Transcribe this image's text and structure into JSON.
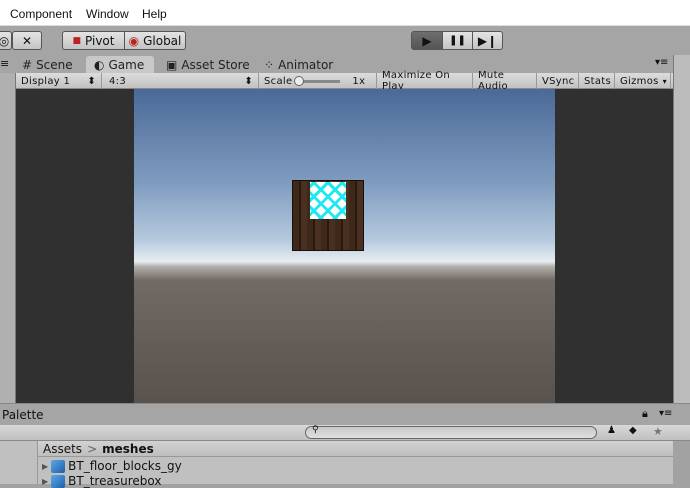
{
  "menu": [
    "Component",
    "Window",
    "Help"
  ],
  "toolbar": {
    "pivot": "Pivot",
    "global": "Global",
    "play": "▶",
    "pause": "❚❚",
    "step": "▶❙"
  },
  "tabs": [
    {
      "label": "Scene",
      "icon": "#"
    },
    {
      "label": "Game",
      "icon": "◐"
    },
    {
      "label": "Asset Store",
      "icon": "▣"
    },
    {
      "label": "Animator",
      "icon": "⁘"
    }
  ],
  "game_toolbar": {
    "display": "Display 1",
    "aspect": "4:3",
    "scale_label": "Scale",
    "scale_value": "1x",
    "maximize": "Maximize On Play",
    "mute": "Mute Audio",
    "vsync": "VSync",
    "stats": "Stats",
    "gizmos": "Gizmos"
  },
  "palette": {
    "title": "Palette"
  },
  "project": {
    "breadcrumb_root": "Assets",
    "breadcrumb_sep": ">",
    "breadcrumb_current": "meshes",
    "items": [
      "BT_floor_blocks_gy",
      "BT_treasurebox"
    ]
  }
}
